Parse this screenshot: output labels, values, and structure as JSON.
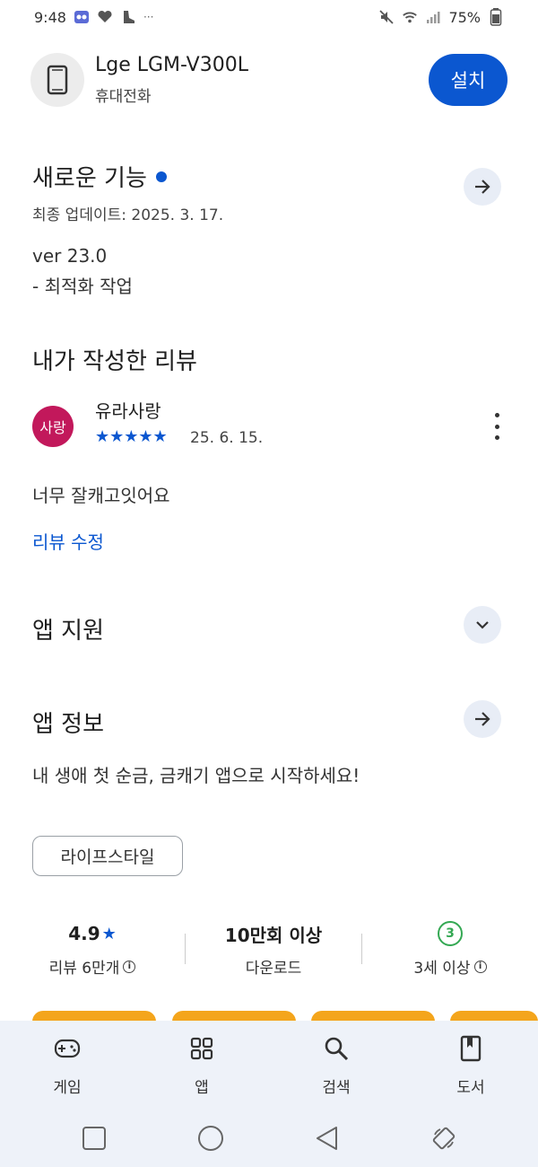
{
  "status_bar": {
    "time": "9:48",
    "battery": "75%"
  },
  "app": {
    "name": "Lge LGM-V300L",
    "category": "휴대전화",
    "install_label": "설치"
  },
  "whats_new": {
    "title": "새로운 기능",
    "date": "최종 업데이트: 2025. 3. 17.",
    "version": "ver 23.0",
    "note": "- 최적화 작업"
  },
  "my_review": {
    "title": "내가 작성한 리뷰",
    "avatar_text": "사랑",
    "reviewer": "유라사랑",
    "stars": "★★★★★",
    "rating": 5,
    "date": "25. 6. 15.",
    "text": "너무 잘캐고잇어요",
    "edit_label": "리뷰 수정"
  },
  "app_support": {
    "title": "앱 지원"
  },
  "app_info": {
    "title": "앱 정보",
    "description": "내 생애 첫 순금, 금캐기 앱으로 시작하세요!",
    "tag": "라이프스타일"
  },
  "stats": {
    "rating_value": "4.9",
    "rating_star": "★",
    "rating_label": "리뷰 6만개",
    "downloads_value": "10만회 이상",
    "downloads_label": "다운로드",
    "age_badge": "3",
    "age_label": "3세 이상"
  },
  "bottom_nav": [
    {
      "label": "게임",
      "icon": "gamepad-icon"
    },
    {
      "label": "앱",
      "icon": "apps-grid-icon"
    },
    {
      "label": "검색",
      "icon": "search-icon"
    },
    {
      "label": "도서",
      "icon": "book-icon"
    }
  ],
  "colors": {
    "accent": "#0b57d0",
    "avatar": "#c2185b",
    "age_badge": "#34a853",
    "card_peek": "#f4a51c",
    "nav_bg": "#eef2f9"
  }
}
